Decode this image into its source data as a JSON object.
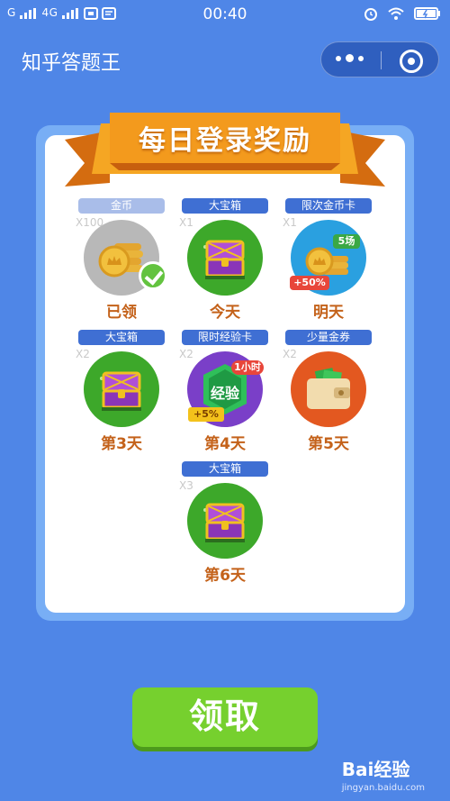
{
  "status_bar": {
    "carrier": "G",
    "network": "4G",
    "time": "00:40"
  },
  "header": {
    "title": "知乎答题王"
  },
  "panel": {
    "title": "每日登录奖励"
  },
  "rewards": [
    {
      "tag": "金币",
      "qty": "X100",
      "day": "已领",
      "icon": "coin-stack-icon",
      "claimed": true
    },
    {
      "tag": "大宝箱",
      "qty": "X1",
      "day": "今天",
      "icon": "treasure-chest-icon"
    },
    {
      "tag": "限次金币卡",
      "qty": "X1",
      "day": "明天",
      "icon": "coin-card-icon",
      "badge_top": "5场",
      "badge_bottom": "+50%"
    },
    {
      "tag": "大宝箱",
      "qty": "X2",
      "day": "第3天",
      "icon": "treasure-chest-icon"
    },
    {
      "tag": "限时经验卡",
      "qty": "X2",
      "day": "第4天",
      "icon": "experience-card-icon",
      "badge_top": "1小时",
      "badge_center": "经验",
      "badge_bottom": "+5%"
    },
    {
      "tag": "少量金券",
      "qty": "X2",
      "day": "第5天",
      "icon": "wallet-icon"
    },
    {
      "tag": "大宝箱",
      "qty": "X3",
      "day": "第6天",
      "icon": "treasure-chest-icon"
    }
  ],
  "claim_button": {
    "label": "领取"
  },
  "watermark": {
    "brand": "Bai经验",
    "site": "jingyan.baidu.com"
  },
  "colors": {
    "background": "#4f86e7",
    "ribbon": "#f39a1d",
    "tag": "#3f6fd3",
    "day_text": "#c4621a",
    "claim": "#76d02e"
  }
}
